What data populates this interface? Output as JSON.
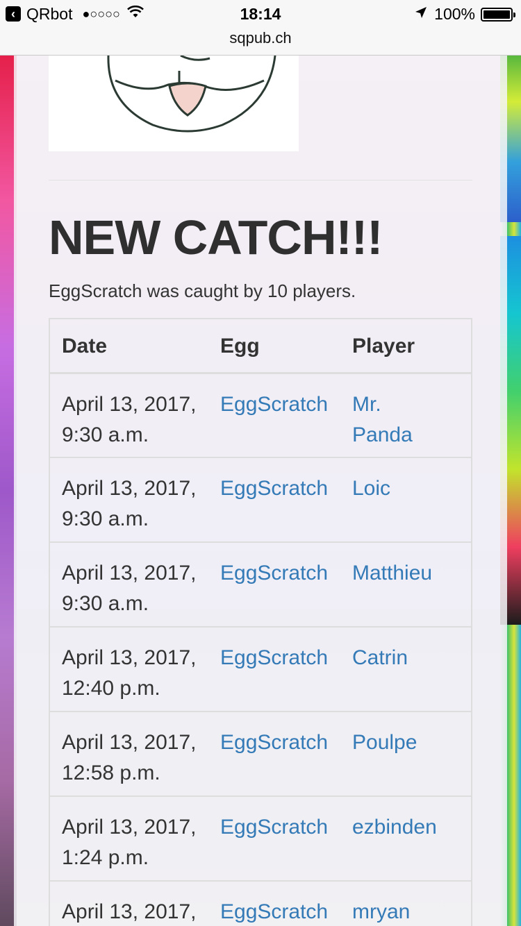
{
  "status_bar": {
    "back_app": "QRbot",
    "signal": "●○○○○",
    "time": "18:14",
    "battery": "100%"
  },
  "url": "sqpub.ch",
  "heading": "NEW CATCH!!!",
  "summary": "EggScratch was caught by 10 players.",
  "table": {
    "headers": [
      "Date",
      "Egg",
      "Player"
    ],
    "rows": [
      {
        "date_line1": "April 13, 2017,",
        "date_line2": "9:30 a.m.",
        "egg": "EggScratch",
        "player_line1": "Mr.",
        "player_line2": "Panda"
      },
      {
        "date_line1": "April 13, 2017,",
        "date_line2": "9:30 a.m.",
        "egg": "EggScratch",
        "player_line1": "Loic",
        "player_line2": ""
      },
      {
        "date_line1": "April 13, 2017,",
        "date_line2": "9:30 a.m.",
        "egg": "EggScratch",
        "player_line1": "Matthieu",
        "player_line2": ""
      },
      {
        "date_line1": "April 13, 2017,",
        "date_line2": "12:40 p.m.",
        "egg": "EggScratch",
        "player_line1": "Catrin",
        "player_line2": ""
      },
      {
        "date_line1": "April 13, 2017,",
        "date_line2": "12:58 p.m.",
        "egg": "EggScratch",
        "player_line1": "Poulpe",
        "player_line2": ""
      },
      {
        "date_line1": "April 13, 2017,",
        "date_line2": "1:24 p.m.",
        "egg": "EggScratch",
        "player_line1": "ezbinden",
        "player_line2": ""
      },
      {
        "date_line1": "April 13, 2017,",
        "date_line2": "",
        "egg": "EggScratch",
        "player_line1": "mryan",
        "player_line2": ""
      }
    ]
  },
  "colors": {
    "link": "#337ab7",
    "heading": "#2f2f2f"
  },
  "icons": {
    "back": "back-chevron-icon",
    "wifi": "wifi-icon",
    "location": "location-arrow-icon",
    "battery": "battery-icon"
  }
}
